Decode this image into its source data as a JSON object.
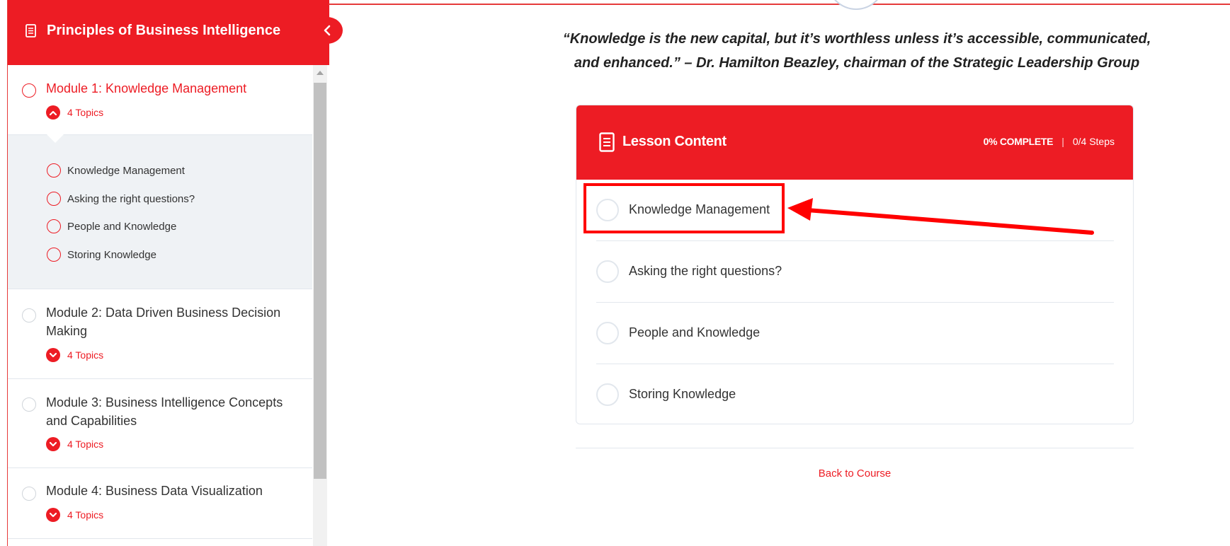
{
  "sidebar": {
    "course_title": "Principles of Business Intelligence",
    "modules": [
      {
        "title": "Module 1: Knowledge Management",
        "topics_label": "4 Topics",
        "expanded": true,
        "topics": [
          "Knowledge Management",
          "Asking the right questions?",
          "People and Knowledge",
          "Storing Knowledge"
        ]
      },
      {
        "title": "Module 2: Data Driven Business Decision Making",
        "topics_label": "4 Topics",
        "expanded": false
      },
      {
        "title": "Module 3: Business Intelligence Concepts and Capabilities",
        "topics_label": "4 Topics",
        "expanded": false
      },
      {
        "title": "Module 4: Business Data Visualization",
        "topics_label": "4 Topics",
        "expanded": false
      }
    ]
  },
  "main": {
    "quote_line1": "“Knowledge is the new capital, but it’s worthless unless it’s accessible, communicated,",
    "quote_line2": "and enhanced.” – Dr. Hamilton Beazley, chairman of the Strategic Leadership Group",
    "lesson": {
      "title": "Lesson Content",
      "progress_percent": "0% COMPLETE",
      "progress_steps": "0/4 Steps",
      "items": [
        "Knowledge Management",
        "Asking the right questions?",
        "People and Knowledge",
        "Storing Knowledge"
      ]
    },
    "back_link": "Back to Course"
  },
  "colors": {
    "accent": "#ed1c24",
    "panel_bg": "#eff2f5",
    "border": "#e2e7ed",
    "annotation": "#ff0000"
  },
  "icons": {
    "course": "book-icon",
    "collapse": "chevron-left-icon",
    "expanded": "chevron-up-icon",
    "collapsed": "chevron-down-icon"
  }
}
